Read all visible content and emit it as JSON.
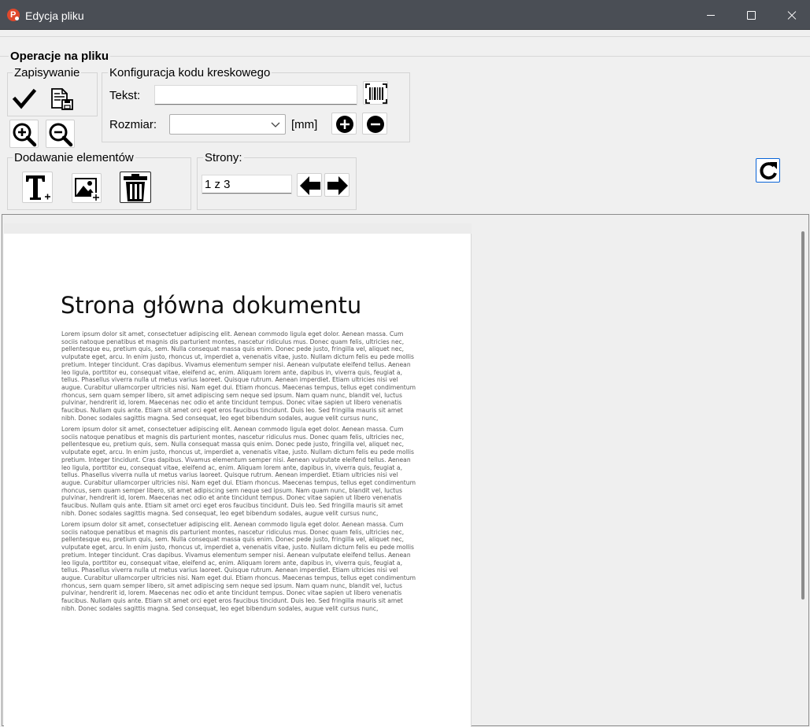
{
  "window": {
    "title": "Edycja pliku"
  },
  "main": {
    "title": "Operacje na pliku"
  },
  "saving": {
    "title": "Zapisywanie"
  },
  "barcode": {
    "title": "Konfiguracja kodu kreskowego",
    "text_label": "Tekst:",
    "text_value": "",
    "size_label": "Rozmiar:",
    "size_value": "",
    "unit": "[mm]"
  },
  "elements": {
    "title": "Dodawanie elementów"
  },
  "pages": {
    "title": "Strony:",
    "current": "1 z 3"
  },
  "document": {
    "heading": "Strona główna dokumentu",
    "paragraphs": [
      "Lorem ipsum dolor sit amet, consectetuer adipiscing elit. Aenean commodo ligula eget dolor. Aenean massa. Cum sociis natoque penatibus et magnis dis parturient montes, nascetur ridiculus mus. Donec quam felis, ultricies nec, pellentesque eu, pretium quis, sem. Nulla consequat massa quis enim. Donec pede justo, fringilla vel, aliquet nec, vulputate eget, arcu. In enim justo, rhoncus ut, imperdiet a, venenatis vitae, justo. Nullam dictum felis eu pede mollis pretium. Integer tincidunt. Cras dapibus. Vivamus elementum semper nisi. Aenean vulputate eleifend tellus. Aenean leo ligula, porttitor eu, consequat vitae, eleifend ac, enim. Aliquam lorem ante, dapibus in, viverra quis, feugiat a, tellus. Phasellus viverra nulla ut metus varius laoreet. Quisque rutrum. Aenean imperdiet. Etiam ultricies nisi vel augue. Curabitur ullamcorper ultricies nisi. Nam eget dui. Etiam rhoncus. Maecenas tempus, tellus eget condimentum rhoncus, sem quam semper libero, sit amet adipiscing sem neque sed ipsum. Nam quam nunc, blandit vel, luctus pulvinar, hendrerit id, lorem. Maecenas nec odio et ante tincidunt tempus. Donec vitae sapien ut libero venenatis faucibus. Nullam quis ante. Etiam sit amet orci eget eros faucibus tincidunt. Duis leo. Sed fringilla mauris sit amet nibh. Donec sodales sagittis magna. Sed consequat, leo eget bibendum sodales, augue velit cursus nunc,",
      "Lorem ipsum dolor sit amet, consectetuer adipiscing elit. Aenean commodo ligula eget dolor. Aenean massa. Cum sociis natoque penatibus et magnis dis parturient montes, nascetur ridiculus mus. Donec quam felis, ultricies nec, pellentesque eu, pretium quis, sem. Nulla consequat massa quis enim. Donec pede justo, fringilla vel, aliquet nec, vulputate eget, arcu. In enim justo, rhoncus ut, imperdiet a, venenatis vitae, justo. Nullam dictum felis eu pede mollis pretium. Integer tincidunt. Cras dapibus. Vivamus elementum semper nisi. Aenean vulputate eleifend tellus. Aenean leo ligula, porttitor eu, consequat vitae, eleifend ac, enim. Aliquam lorem ante, dapibus in, viverra quis, feugiat a, tellus. Phasellus viverra nulla ut metus varius laoreet. Quisque rutrum. Aenean imperdiet. Etiam ultricies nisi vel augue. Curabitur ullamcorper ultricies nisi. Nam eget dui. Etiam rhoncus. Maecenas tempus, tellus eget condimentum rhoncus, sem quam semper libero, sit amet adipiscing sem neque sed ipsum. Nam quam nunc, blandit vel, luctus pulvinar, hendrerit id, lorem. Maecenas nec odio et ante tincidunt tempus. Donec vitae sapien ut libero venenatis faucibus. Nullam quis ante. Etiam sit amet orci eget eros faucibus tincidunt. Duis leo. Sed fringilla mauris sit amet nibh. Donec sodales sagittis magna. Sed consequat, leo eget bibendum sodales, augue velit cursus nunc,",
      "Lorem ipsum dolor sit amet, consectetuer adipiscing elit. Aenean commodo ligula eget dolor. Aenean massa. Cum sociis natoque penatibus et magnis dis parturient montes, nascetur ridiculus mus. Donec quam felis, ultricies nec, pellentesque eu, pretium quis, sem. Nulla consequat massa quis enim. Donec pede justo, fringilla vel, aliquet nec, vulputate eget, arcu. In enim justo, rhoncus ut, imperdiet a, venenatis vitae, justo. Nullam dictum felis eu pede mollis pretium. Integer tincidunt. Cras dapibus. Vivamus elementum semper nisi. Aenean vulputate eleifend tellus. Aenean leo ligula, porttitor eu, consequat vitae, eleifend ac, enim. Aliquam lorem ante, dapibus in, viverra quis, feugiat a, tellus. Phasellus viverra nulla ut metus varius laoreet. Quisque rutrum. Aenean imperdiet. Etiam ultricies nisi vel augue. Curabitur ullamcorper ultricies nisi. Nam eget dui. Etiam rhoncus. Maecenas tempus, tellus eget condimentum rhoncus, sem quam semper libero, sit amet adipiscing sem neque sed ipsum. Nam quam nunc, blandit vel, luctus pulvinar, hendrerit id, lorem. Maecenas nec odio et ante tincidunt tempus. Donec vitae sapien ut libero venenatis faucibus. Nullam quis ante. Etiam sit amet orci eget eros faucibus tincidunt. Duis leo. Sed fringilla mauris sit amet nibh. Donec sodales sagittis magna. Sed consequat, leo eget bibendum sodales, augue velit cursus nunc,"
    ]
  },
  "icons": {
    "app": "app-logo-icon",
    "save": "checkmark-icon",
    "save_as": "save-document-icon",
    "zoom_in": "zoom-in-icon",
    "zoom_out": "zoom-out-icon",
    "barcode": "barcode-icon",
    "increase": "plus-circle-icon",
    "decrease": "minus-circle-icon",
    "add_text": "add-text-icon",
    "add_image": "add-image-icon",
    "delete": "trash-icon",
    "prev": "arrow-left-icon",
    "next": "arrow-right-icon",
    "refresh": "refresh-icon"
  },
  "colors": {
    "titlebar": "#4a4e55",
    "app_icon": "#e0482c",
    "background": "#f0f0f0",
    "refresh_border": "#0a64d8"
  }
}
